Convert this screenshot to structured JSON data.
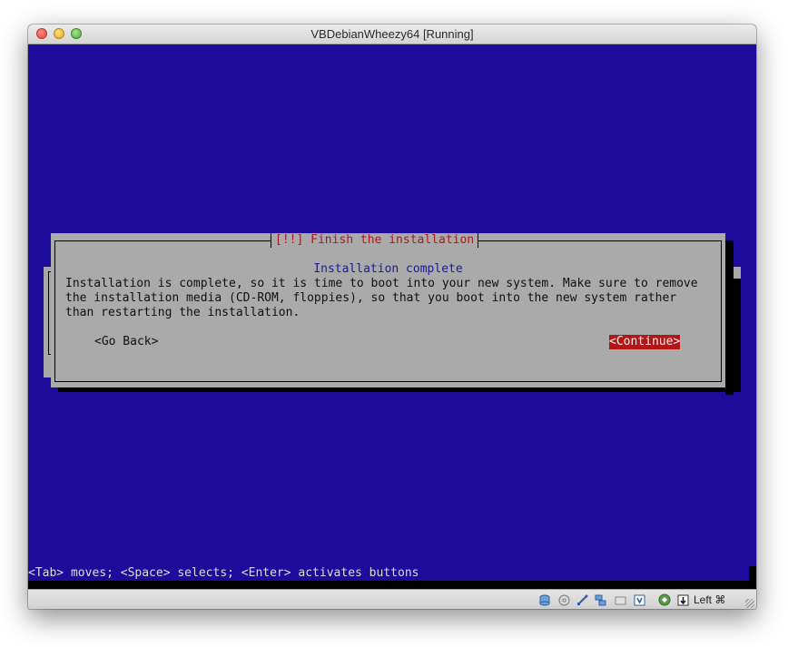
{
  "window": {
    "title": "VBDebianWheezy64 [Running]"
  },
  "dialog": {
    "title": "[!!] Finish the installation",
    "heading": "Installation complete",
    "body": "Installation is complete, so it is time to boot into your new system. Make sure to remove\nthe installation media (CD-ROM, floppies), so that you boot into the new system rather\nthan restarting the installation.",
    "go_back_label": "<Go Back>",
    "continue_label": "<Continue>"
  },
  "hint_bar": {
    "text": "<Tab> moves; <Space> selects; <Enter> activates buttons"
  },
  "status_bar": {
    "icons": [
      "hard-disk-icon",
      "optical-drive-icon",
      "usb-icon",
      "network-icon",
      "shared-folders-icon",
      "display-icon",
      "video-capture-icon",
      "mouse-integration-icon",
      "keyboard-capture-icon"
    ],
    "host_key_label": "Left ⌘"
  },
  "colors": {
    "screen_background": "#1e0b9c",
    "dialog_background": "#aaaaaa",
    "title_text": "#a81c1c",
    "heading_text": "#1a1aa0",
    "selected_button": "#b01818"
  }
}
